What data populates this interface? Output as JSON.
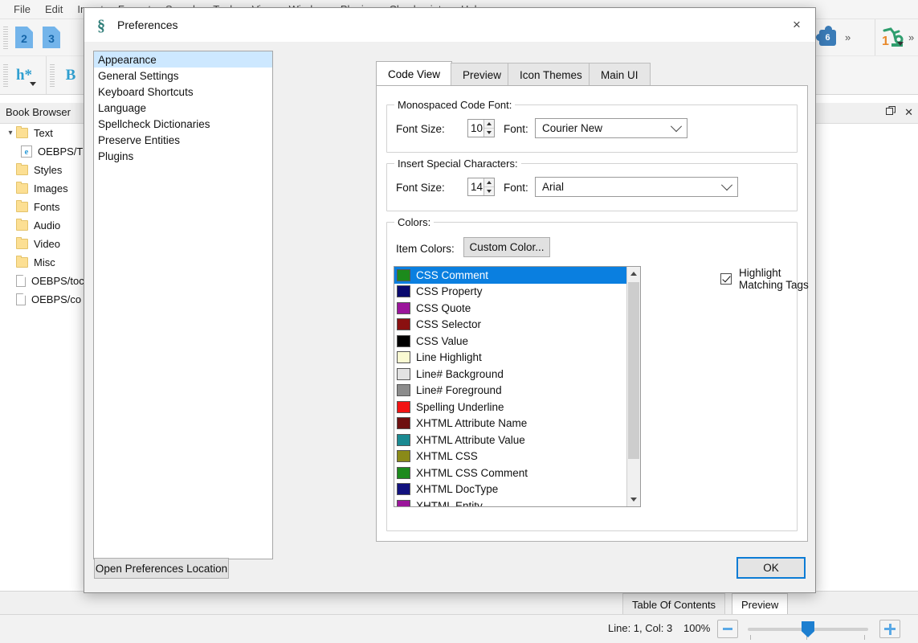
{
  "app": {
    "menubar": [
      "File",
      "Edit",
      "Insert",
      "Format",
      "Search",
      "Tools",
      "View",
      "Window",
      "Plugins",
      "Checkpoints",
      "Help"
    ],
    "toolbar": {
      "heading2": "2",
      "heading3": "3",
      "heading_multi": "h*",
      "bold": "B",
      "plugin_count": "6",
      "automate_num": "1",
      "overflow": "»"
    },
    "dock": {
      "title": "Book Browser",
      "float_icon": "float-icon",
      "close_icon": "close-icon"
    },
    "tree": [
      {
        "label": "Text",
        "type": "folder",
        "expanded": true,
        "depth": 0
      },
      {
        "label": "OEBPS/T",
        "type": "html",
        "depth": 1
      },
      {
        "label": "Styles",
        "type": "folder",
        "depth": 0
      },
      {
        "label": "Images",
        "type": "folder",
        "depth": 0
      },
      {
        "label": "Fonts",
        "type": "folder",
        "depth": 0
      },
      {
        "label": "Audio",
        "type": "folder",
        "depth": 0
      },
      {
        "label": "Video",
        "type": "folder",
        "depth": 0
      },
      {
        "label": "Misc",
        "type": "folder",
        "depth": 0
      },
      {
        "label": "OEBPS/toc",
        "type": "file",
        "depth": 0
      },
      {
        "label": "OEBPS/co",
        "type": "file",
        "depth": 0
      }
    ],
    "bottom_tabs": [
      {
        "label": "Table Of Contents",
        "selected": false
      },
      {
        "label": "Preview",
        "selected": true
      }
    ],
    "statusbar": {
      "position": "Line: 1, Col: 3",
      "zoom": "100%",
      "zoom_out_icon": "minus-icon",
      "zoom_in_icon": "plus-icon"
    }
  },
  "dialog": {
    "title": "Preferences",
    "logo": "§",
    "close_icon": "×",
    "sidebar": [
      {
        "label": "Appearance",
        "selected": true
      },
      {
        "label": "General Settings",
        "selected": false
      },
      {
        "label": "Keyboard Shortcuts",
        "selected": false
      },
      {
        "label": "Language",
        "selected": false
      },
      {
        "label": "Spellcheck Dictionaries",
        "selected": false
      },
      {
        "label": "Preserve Entities",
        "selected": false
      },
      {
        "label": "Plugins",
        "selected": false
      }
    ],
    "tabs": [
      {
        "label": "Code View",
        "selected": true
      },
      {
        "label": "Preview",
        "selected": false
      },
      {
        "label": "Icon Themes",
        "selected": false
      },
      {
        "label": "Main UI",
        "selected": false
      }
    ],
    "groups": {
      "mono_font": {
        "legend": "Monospaced Code Font:",
        "size_label": "Font Size:",
        "size_value": "10",
        "font_label": "Font:",
        "font_value": "Courier New"
      },
      "special_chars": {
        "legend": "Insert Special Characters:",
        "size_label": "Font Size:",
        "size_value": "14",
        "font_label": "Font:",
        "font_value": "Arial"
      },
      "colors": {
        "legend": "Colors:",
        "item_colors_label": "Item Colors:",
        "custom_color_button": "Custom Color...",
        "highlight_checkbox": "Highlight Matching Tags",
        "highlight_checked": true,
        "items": [
          {
            "label": "CSS Comment",
            "color": "#1c8a1c",
            "selected": true
          },
          {
            "label": "CSS Property",
            "color": "#0a0a6e",
            "selected": false
          },
          {
            "label": "CSS Quote",
            "color": "#9b159b",
            "selected": false
          },
          {
            "label": "CSS Selector",
            "color": "#8a1010",
            "selected": false
          },
          {
            "label": "CSS Value",
            "color": "#000000",
            "selected": false
          },
          {
            "label": "Line Highlight",
            "color": "#fafad2",
            "selected": false
          },
          {
            "label": "Line# Background",
            "color": "#e2e2e2",
            "selected": false
          },
          {
            "label": "Line# Foreground",
            "color": "#8c8c8c",
            "selected": false
          },
          {
            "label": "Spelling Underline",
            "color": "#f21414",
            "selected": false
          },
          {
            "label": "XHTML Attribute Name",
            "color": "#6e1010",
            "selected": false
          },
          {
            "label": "XHTML Attribute Value",
            "color": "#1a8a92",
            "selected": false
          },
          {
            "label": "XHTML CSS",
            "color": "#8a8a18",
            "selected": false
          },
          {
            "label": "XHTML CSS Comment",
            "color": "#1c8a1c",
            "selected": false
          },
          {
            "label": "XHTML DocType",
            "color": "#12127e",
            "selected": false
          },
          {
            "label": "XHTML Entity",
            "color": "#9b159b",
            "selected": false
          }
        ]
      }
    },
    "buttons": {
      "open_prefs_location": "Open Preferences Location",
      "ok": "OK"
    }
  }
}
